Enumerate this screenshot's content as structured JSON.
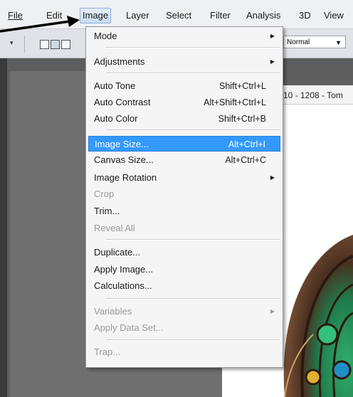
{
  "menubar": {
    "items": [
      {
        "label": "File",
        "left": 0
      },
      {
        "label": "Edit"
      },
      {
        "label": "Image"
      },
      {
        "label": "Layer"
      },
      {
        "label": "Select"
      },
      {
        "label": "Filter"
      },
      {
        "label": "Analysis"
      },
      {
        "label": "3D"
      },
      {
        "label": "View"
      }
    ]
  },
  "options": {
    "blend_mode": "Normal"
  },
  "document": {
    "tab_title": "10 - 1208 - Tom"
  },
  "image_menu": {
    "items": [
      {
        "label": "Mode",
        "shortcut": "",
        "submenu": true,
        "disabled": false
      },
      {
        "label": "Adjustments",
        "shortcut": "",
        "submenu": true,
        "disabled": false
      },
      {
        "label": "Auto Tone",
        "shortcut": "Shift+Ctrl+L",
        "submenu": false,
        "disabled": false
      },
      {
        "label": "Auto Contrast",
        "shortcut": "Alt+Shift+Ctrl+L",
        "submenu": false,
        "disabled": false
      },
      {
        "label": "Auto Color",
        "shortcut": "Shift+Ctrl+B",
        "submenu": false,
        "disabled": false
      },
      {
        "label": "Image Size...",
        "shortcut": "Alt+Ctrl+I",
        "submenu": false,
        "disabled": false,
        "highlighted": true
      },
      {
        "label": "Canvas Size...",
        "shortcut": "Alt+Ctrl+C",
        "submenu": false,
        "disabled": false
      },
      {
        "label": "Image Rotation",
        "shortcut": "",
        "submenu": true,
        "disabled": false
      },
      {
        "label": "Crop",
        "shortcut": "",
        "submenu": false,
        "disabled": true
      },
      {
        "label": "Trim...",
        "shortcut": "",
        "submenu": false,
        "disabled": false
      },
      {
        "label": "Reveal All",
        "shortcut": "",
        "submenu": false,
        "disabled": true
      },
      {
        "label": "Duplicate...",
        "shortcut": "",
        "submenu": false,
        "disabled": false
      },
      {
        "label": "Apply Image...",
        "shortcut": "",
        "submenu": false,
        "disabled": false
      },
      {
        "label": "Calculations...",
        "shortcut": "",
        "submenu": false,
        "disabled": false
      },
      {
        "label": "Variables",
        "shortcut": "",
        "submenu": true,
        "disabled": true
      },
      {
        "label": "Apply Data Set...",
        "shortcut": "",
        "submenu": false,
        "disabled": true
      },
      {
        "label": "Trap...",
        "shortcut": "",
        "submenu": false,
        "disabled": true
      }
    ]
  },
  "colors": {
    "highlight": "#3399ff",
    "disabled_text": "#9a9a9a"
  }
}
